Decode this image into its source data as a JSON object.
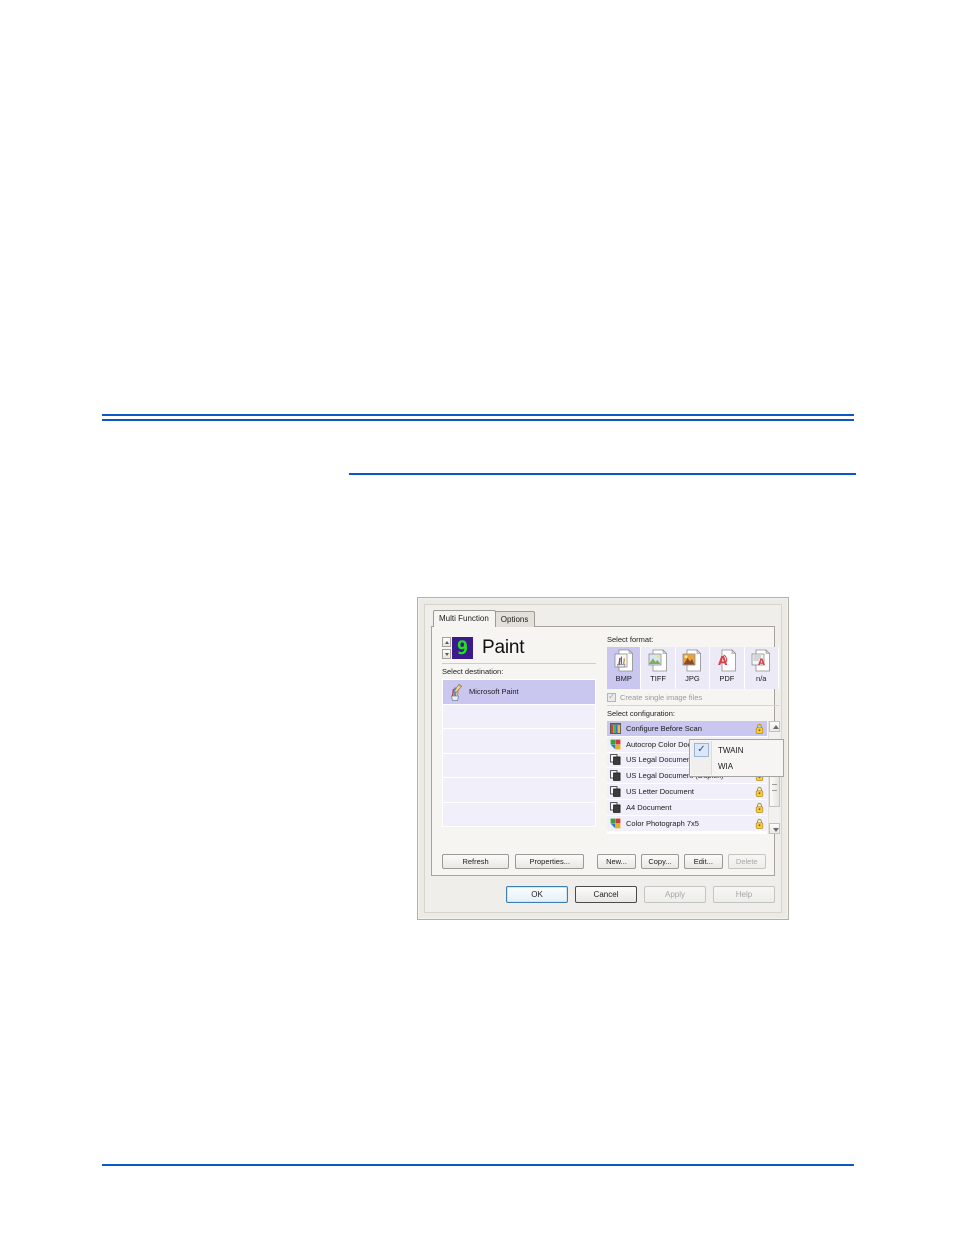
{
  "page": {
    "background": "#ffffff",
    "rule_color": "#0d59c4"
  },
  "dialog": {
    "tabs": [
      {
        "label": "Multi Function",
        "active": true
      },
      {
        "label": "Options",
        "active": false
      }
    ],
    "button_number": "9",
    "app_title": "Paint",
    "destination": {
      "label": "Select destination:",
      "items": [
        {
          "label": "Microsoft Paint",
          "icon": "paint-cup-icon",
          "selected": true
        },
        {
          "label": "",
          "icon": "",
          "selected": false
        },
        {
          "label": "",
          "icon": "",
          "selected": false
        },
        {
          "label": "",
          "icon": "",
          "selected": false
        },
        {
          "label": "",
          "icon": "",
          "selected": false
        },
        {
          "label": "",
          "icon": "",
          "selected": false
        }
      ]
    },
    "format": {
      "label": "Select format:",
      "items": [
        {
          "label": "BMP",
          "icon": "bmp-file-icon",
          "selected": true
        },
        {
          "label": "TIFF",
          "icon": "tiff-file-icon",
          "selected": false
        },
        {
          "label": "JPG",
          "icon": "jpg-file-icon",
          "selected": false
        },
        {
          "label": "PDF",
          "icon": "pdf-file-icon",
          "selected": false
        },
        {
          "label": "n/a",
          "icon": "text-file-icon",
          "selected": false
        }
      ],
      "checkbox_label": "Create single image files",
      "checkbox_checked": true,
      "checkbox_disabled": true
    },
    "configuration": {
      "label": "Select configuration:",
      "items": [
        {
          "label": "Configure Before Scan",
          "icon": "color-grid-icon",
          "locked": true,
          "selected": true
        },
        {
          "label": "Autocrop Color Document",
          "icon": "color-pages-icon",
          "locked": true,
          "selected": false
        },
        {
          "label": "US Legal Document",
          "icon": "gray-pages-icon",
          "locked": true,
          "selected": false
        },
        {
          "label": "US Legal Document (Duplex)",
          "icon": "gray-pages-icon",
          "locked": true,
          "selected": false
        },
        {
          "label": "US Letter Document",
          "icon": "gray-pages-icon",
          "locked": true,
          "selected": false
        },
        {
          "label": "A4 Document",
          "icon": "gray-pages-icon",
          "locked": true,
          "selected": false
        },
        {
          "label": "Color Photograph 7x5",
          "icon": "color-pages-icon",
          "locked": true,
          "selected": false
        }
      ]
    },
    "context_menu": {
      "items": [
        {
          "label": "TWAIN",
          "checked": true
        },
        {
          "label": "WIA",
          "checked": false
        }
      ]
    },
    "action_buttons": [
      {
        "label": "Refresh",
        "disabled": false
      },
      {
        "label": "Properties...",
        "disabled": false
      },
      {
        "label": "New...",
        "disabled": false
      },
      {
        "label": "Copy...",
        "disabled": false
      },
      {
        "label": "Edit...",
        "disabled": false
      },
      {
        "label": "Delete",
        "disabled": true
      }
    ],
    "footer_buttons": [
      {
        "label": "OK",
        "disabled": false,
        "style": "default"
      },
      {
        "label": "Cancel",
        "disabled": false,
        "style": "strong"
      },
      {
        "label": "Apply",
        "disabled": true,
        "style": "normal"
      },
      {
        "label": "Help",
        "disabled": true,
        "style": "normal"
      }
    ]
  }
}
